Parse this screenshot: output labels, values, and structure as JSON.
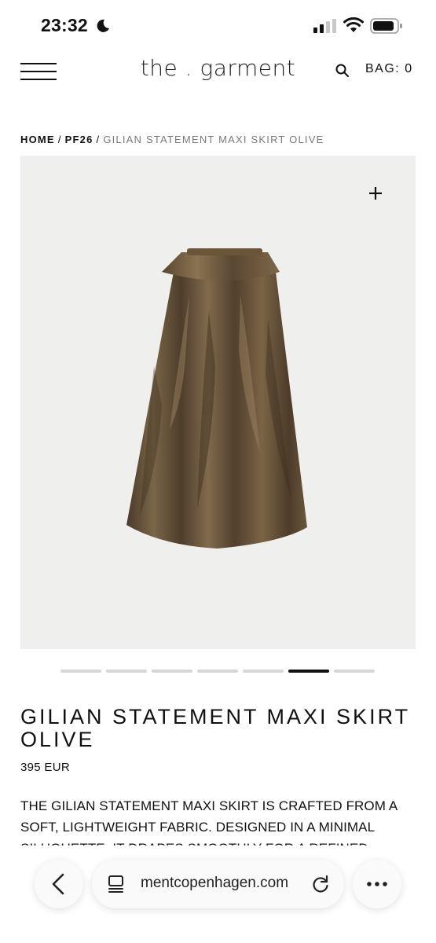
{
  "status_bar": {
    "time": "23:32"
  },
  "header": {
    "brand": "the . garment",
    "bag_label": "BAG:",
    "bag_count": "0"
  },
  "breadcrumb": {
    "home": "HOME",
    "section": "PF26",
    "current": "GILIAN STATEMENT MAXI SKIRT OLIVE",
    "separator": "/"
  },
  "gallery": {
    "zoom_label": "+",
    "slide_count": 7,
    "active_slide": 6
  },
  "product": {
    "title": "GILIAN STATEMENT MAXI SKIRT OLIVE",
    "price": "395 EUR",
    "description": "THE GILIAN STATEMENT MAXI SKIRT IS CRAFTED FROM A SOFT, LIGHTWEIGHT FABRIC. DESIGNED IN A MINIMAL SILHOUETTE, IT DRAPES SMOOTHLY FOR A REFINED"
  },
  "browser": {
    "url": "mentcopenhagen.com"
  },
  "icons": {
    "menu": "hamburger-icon",
    "search": "search-icon",
    "zoom": "plus-icon",
    "back": "chevron-left-icon",
    "tabs": "tabs-icon",
    "reload": "reload-icon",
    "more": "more-icon"
  },
  "colors": {
    "image_background": "#efefed",
    "skirt": "#5c4a35",
    "active_dot": "#111111",
    "inactive_dot": "#d6d6d6"
  }
}
